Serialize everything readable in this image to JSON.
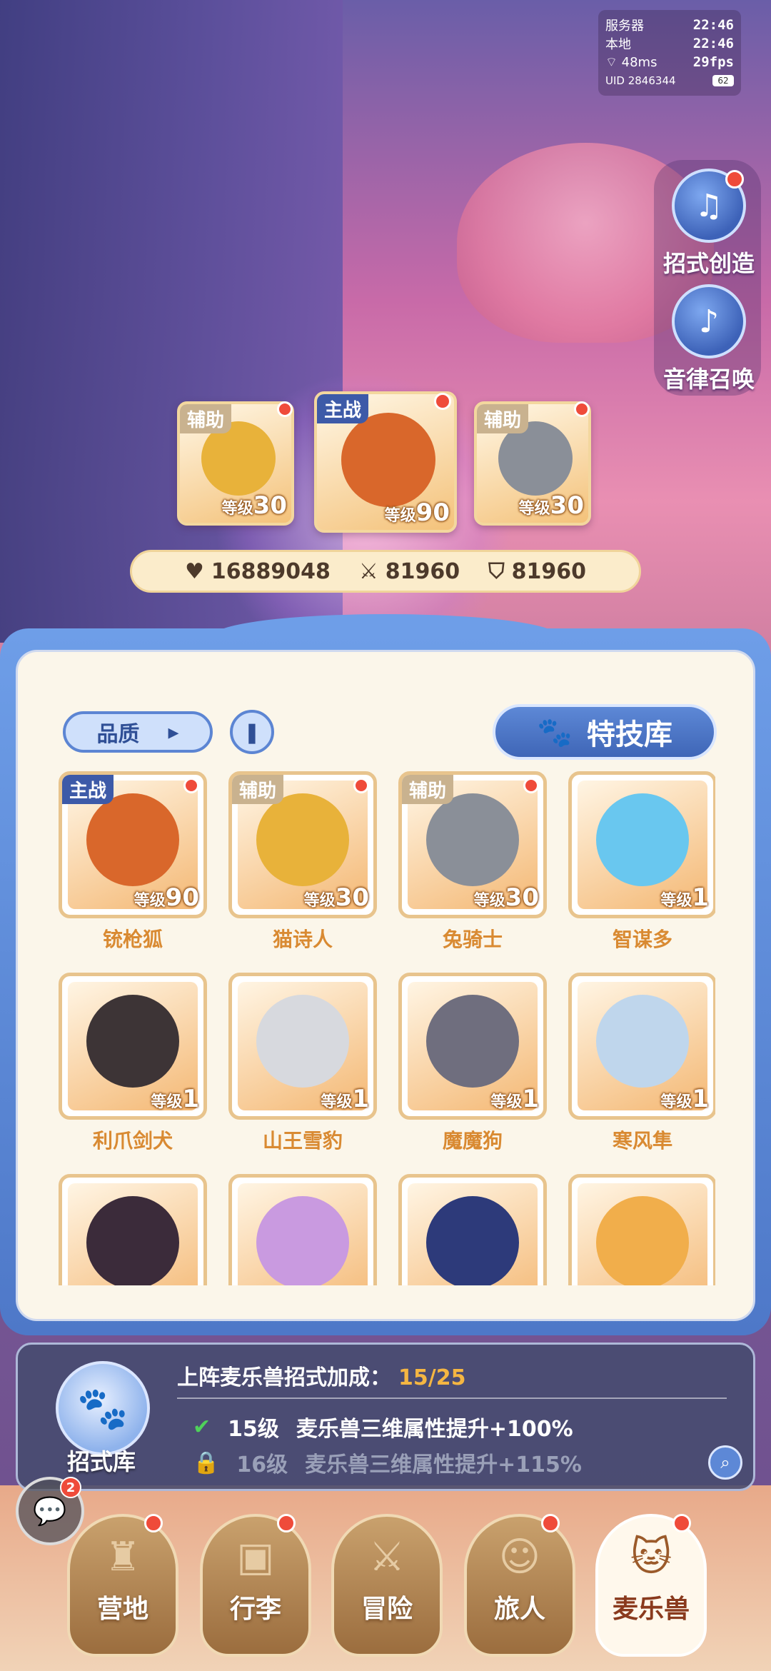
{
  "status": {
    "server_label": "服务器",
    "server_time": "22:46",
    "local_label": "本地",
    "local_time": "22:46",
    "ping": "48ms",
    "fps": "29fps",
    "uid": "UID 2846344",
    "battery": "62"
  },
  "side_buttons": [
    {
      "label": "招式创造",
      "icon": "skill-create-icon"
    },
    {
      "label": "音律召唤",
      "icon": "lyre-icon"
    }
  ],
  "team": [
    {
      "role": "辅助",
      "level_prefix": "等级",
      "level": "30"
    },
    {
      "role": "主战",
      "level_prefix": "等级",
      "level": "90"
    },
    {
      "role": "辅助",
      "level_prefix": "等级",
      "level": "30"
    }
  ],
  "stats": {
    "hp": "16889048",
    "attack": "81960",
    "defense": "81960"
  },
  "panel": {
    "quality_label": "品质",
    "skill_library_label": "特技库"
  },
  "pets": [
    {
      "name": "铳枪狐",
      "role": "主战",
      "level_prefix": "等级",
      "level": "90",
      "color": "#d9672b"
    },
    {
      "name": "猫诗人",
      "role": "辅助",
      "level_prefix": "等级",
      "level": "30",
      "color": "#e8b23a"
    },
    {
      "name": "兔骑士",
      "role": "辅助",
      "level_prefix": "等级",
      "level": "30",
      "color": "#8a8f98"
    },
    {
      "name": "智谋多",
      "role": "",
      "level_prefix": "等级",
      "level": "1",
      "color": "#69c7ef"
    },
    {
      "name": "利爪剑犬",
      "role": "",
      "level_prefix": "等级",
      "level": "1",
      "color": "#3d3436"
    },
    {
      "name": "山王雪豹",
      "role": "",
      "level_prefix": "等级",
      "level": "1",
      "color": "#d7d9de"
    },
    {
      "name": "魔魔狗",
      "role": "",
      "level_prefix": "等级",
      "level": "1",
      "color": "#6f6e7e"
    },
    {
      "name": "寒风隼",
      "role": "",
      "level_prefix": "等级",
      "level": "1",
      "color": "#bfd6ec"
    },
    {
      "name": "",
      "role": "",
      "level_prefix": "",
      "level": "",
      "color": "#3b2b3a"
    },
    {
      "name": "",
      "role": "",
      "level_prefix": "",
      "level": "",
      "color": "#c99ae0"
    },
    {
      "name": "",
      "role": "",
      "level_prefix": "",
      "level": "",
      "color": "#2d3a7a"
    },
    {
      "name": "",
      "role": "",
      "level_prefix": "",
      "level": "",
      "color": "#f1ae4b"
    }
  ],
  "bonus": {
    "title": "上阵麦乐兽招式加成：",
    "progress": "15/25",
    "rows": [
      {
        "level": "15级",
        "text": "麦乐兽三维属性提升+100%",
        "unlocked": true
      },
      {
        "level": "16级",
        "text": "麦乐兽三维属性提升+115%",
        "unlocked": false
      }
    ],
    "library_label": "招式库"
  },
  "chat_badge": "2",
  "nav": [
    {
      "label": "营地",
      "icon": "castle-icon"
    },
    {
      "label": "行李",
      "icon": "backpack-icon"
    },
    {
      "label": "冒险",
      "icon": "crossed-swords-icon"
    },
    {
      "label": "旅人",
      "icon": "traveler-icon"
    },
    {
      "label": "麦乐兽",
      "icon": "pet-icon",
      "active": true
    }
  ]
}
